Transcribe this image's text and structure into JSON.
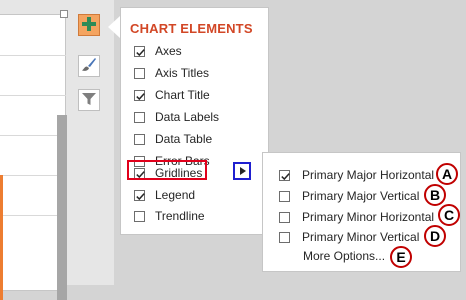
{
  "popup": {
    "title": "CHART ELEMENTS",
    "items": [
      {
        "label": "Axes",
        "checked": true
      },
      {
        "label": "Axis Titles",
        "checked": false
      },
      {
        "label": "Chart Title",
        "checked": true
      },
      {
        "label": "Data Labels",
        "checked": false
      },
      {
        "label": "Data Table",
        "checked": false
      },
      {
        "label": "Error Bars",
        "checked": false
      },
      {
        "label": "Gridlines",
        "checked": true
      },
      {
        "label": "Legend",
        "checked": true
      },
      {
        "label": "Trendline",
        "checked": false
      }
    ]
  },
  "submenu": {
    "items": [
      {
        "label": "Primary Major Horizontal",
        "checked": true,
        "marker": "A"
      },
      {
        "label": "Primary Major Vertical",
        "checked": false,
        "marker": "B"
      },
      {
        "label": "Primary Minor Horizontal",
        "checked": false,
        "marker": "C"
      },
      {
        "label": "Primary Minor Vertical",
        "checked": false,
        "marker": "D"
      }
    ],
    "more_options": "More Options...",
    "more_marker": "E"
  },
  "toolbar": {
    "plus_icon": "plus-icon",
    "brush_icon": "paintbrush-icon",
    "filter_icon": "filter-icon"
  },
  "colors": {
    "accent": "#d24726",
    "highlight_red": "#e0001b",
    "highlight_blue": "#1f1fcf",
    "marker_border": "#c00000",
    "plus_button": "#f4a460"
  }
}
